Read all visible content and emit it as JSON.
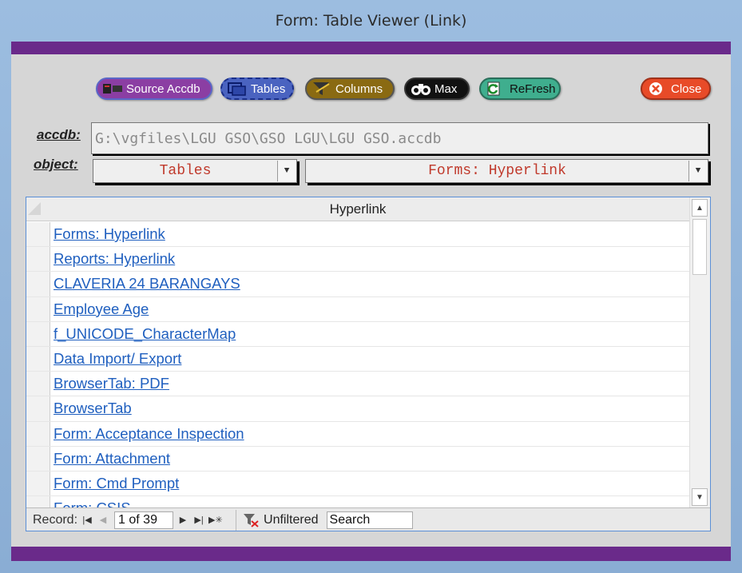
{
  "window": {
    "title": "Form: Table Viewer (Link)"
  },
  "toolbar": {
    "source_label": "Source Accdb",
    "tables_label": "Tables",
    "columns_label": "Columns",
    "max_label": "Max",
    "refresh_label": "ReFresh",
    "close_label": "Close"
  },
  "labels": {
    "accdb": "accdb:",
    "object": "object:"
  },
  "path": {
    "value": "G:\\vgfiles\\LGU GSO\\GSO LGU\\LGU GSO.accdb"
  },
  "object_type": {
    "selected": "Tables"
  },
  "object_name": {
    "selected": "Forms: Hyperlink"
  },
  "grid": {
    "column_header": "Hyperlink",
    "rows": [
      "Forms: Hyperlink",
      "Reports: Hyperlink",
      "CLAVERIA 24 BARANGAYS",
      "Employee Age",
      "f_UNICODE_CharacterMap",
      "Data Import/ Export",
      "BrowserTab: PDF",
      "BrowserTab",
      "Form: Acceptance Inspection",
      "Form: Attachment",
      "Form: Cmd Prompt",
      "Form: CSIS..."
    ]
  },
  "navigation": {
    "record_label": "Record:",
    "record_position": "1 of 39",
    "filter_label": "Unfiltered",
    "search_placeholder": "Search"
  },
  "colors": {
    "frame_bar": "#6a2a8a",
    "link": "#1f5fbf"
  }
}
